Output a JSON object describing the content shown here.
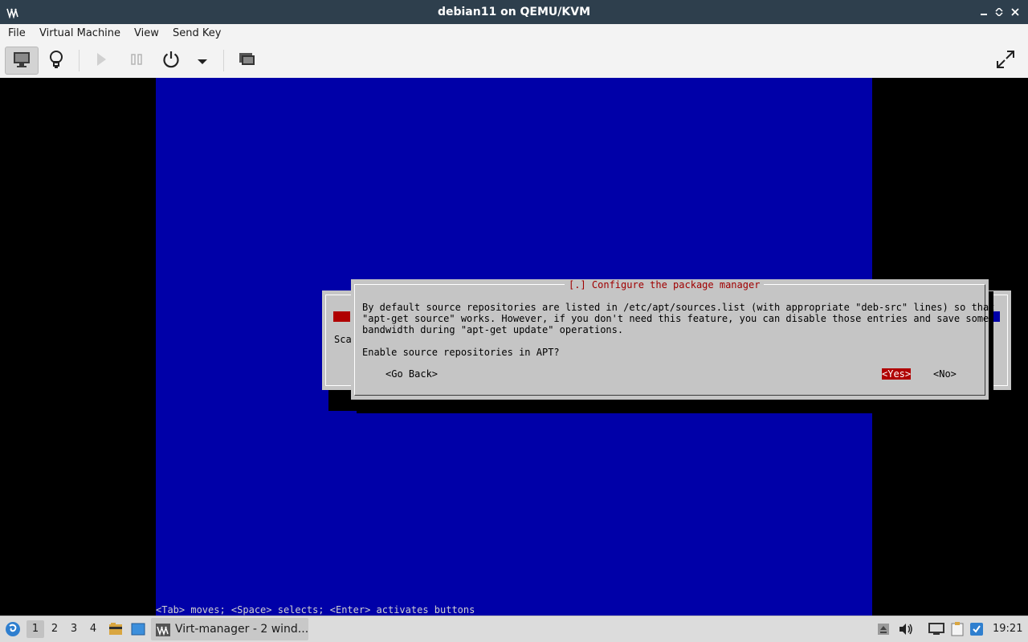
{
  "window": {
    "title": "debian11 on QEMU/KVM",
    "app_icon": "virt-manager-icon",
    "controls": [
      "minimize-icon",
      "maximize-icon",
      "close-icon"
    ]
  },
  "menu": {
    "file": "File",
    "virtual_machine": "Virtual Machine",
    "view": "View",
    "send_key": "Send Key"
  },
  "toolbar": {
    "buttons": [
      "console-icon",
      "details-lightbulb-icon",
      "run-icon",
      "pause-icon",
      "power-icon",
      "chevron-down-icon",
      "snapshots-icon",
      "fullscreen-icon"
    ]
  },
  "installer": {
    "background_dialog": {
      "partial_text": "Sca"
    },
    "dialog": {
      "title": "[.] Configure the package manager",
      "lines": [
        "By default source repositories are listed in /etc/apt/sources.list (with appropriate \"deb-src\" lines) so that",
        "\"apt-get source\" works. However, if you don't need this feature, you can disable those entries and save some",
        "bandwidth during \"apt-get update\" operations."
      ],
      "question": "Enable source repositories in APT?",
      "go_back": "<Go Back>",
      "yes": "<Yes>",
      "no": "<No>",
      "selected": "yes"
    },
    "status_line": "<Tab> moves; <Space> selects; <Enter> activates buttons",
    "colors": {
      "background": "#0000a8",
      "dialog": "#c5c5c5",
      "accent": "#b00000"
    }
  },
  "taskbar": {
    "workspaces": [
      "1",
      "2",
      "3",
      "4"
    ],
    "current_workspace": "1",
    "task_label": "Virt-manager - 2 wind...",
    "clock": "19:21",
    "tray_icons": [
      "eject-icon",
      "volume-icon",
      "network-icon",
      "clipboard-icon",
      "updates-icon"
    ]
  }
}
